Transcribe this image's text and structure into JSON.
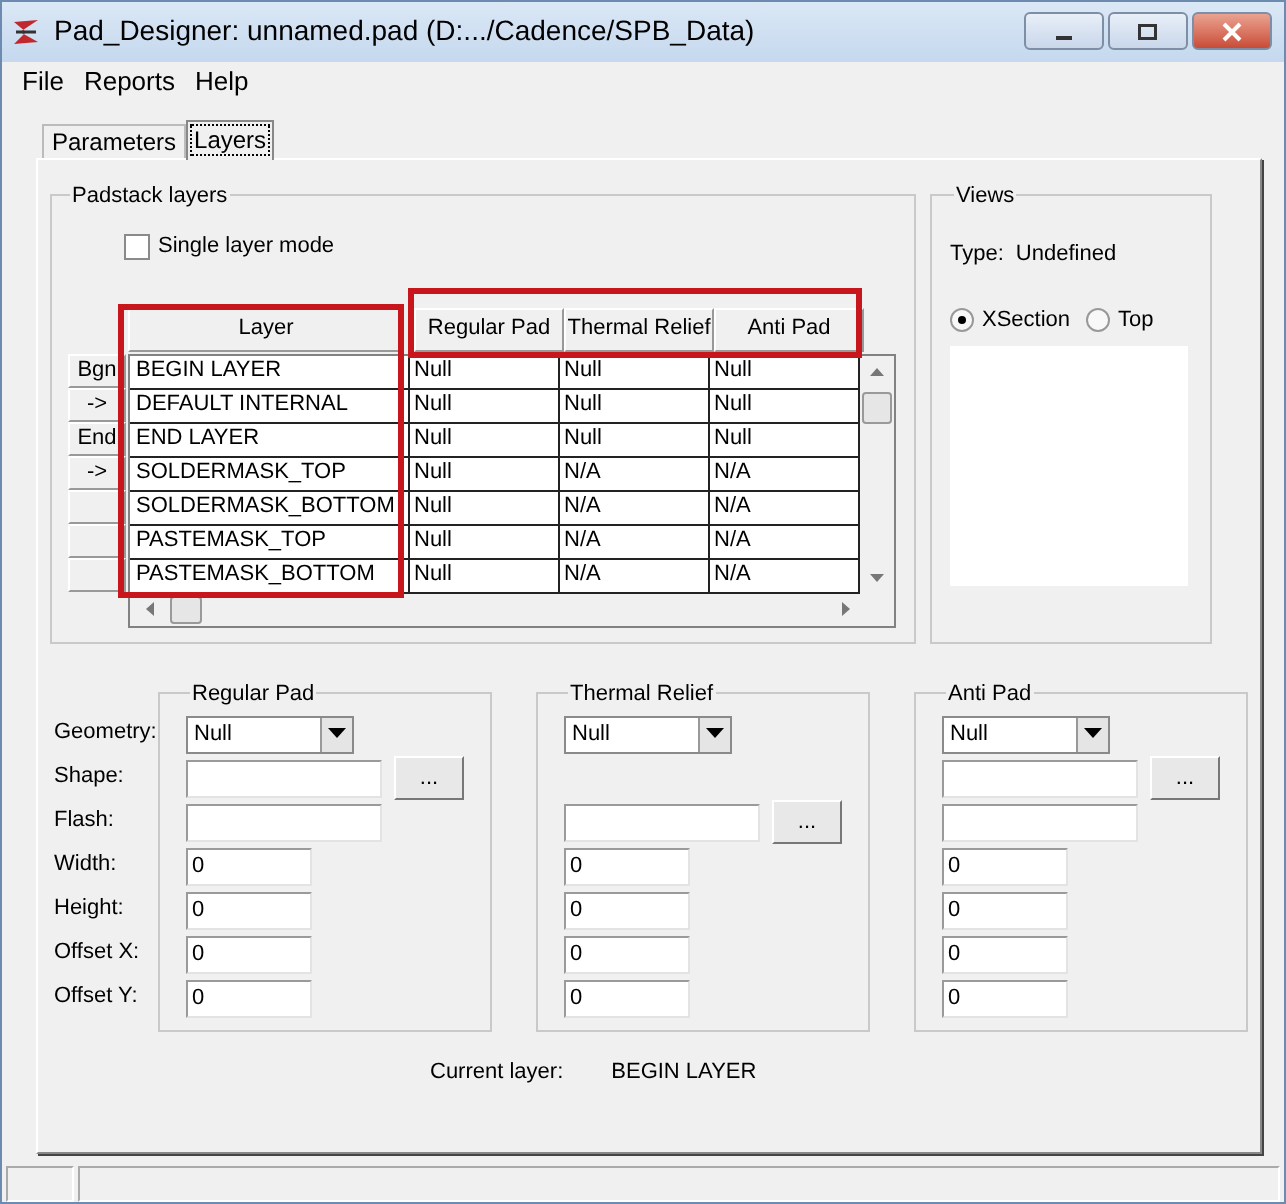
{
  "window": {
    "title": "Pad_Designer: unnamed.pad (D:.../Cadence/SPB_Data)"
  },
  "menu": [
    "File",
    "Reports",
    "Help"
  ],
  "tabs": [
    {
      "label": "Parameters",
      "selected": false
    },
    {
      "label": "Layers",
      "selected": true
    }
  ],
  "padstack_layers": {
    "title": "Padstack layers",
    "single_layer_mode": {
      "label": "Single layer mode",
      "checked": false
    },
    "table": {
      "layer_header": "Layer",
      "pad_headers": [
        "Regular Pad",
        "Thermal Relief",
        "Anti Pad"
      ],
      "layer_column_highlighted": true,
      "pad_headers_highlighted": true,
      "rows": [
        {
          "row_button": "Bgn",
          "layer": "BEGIN LAYER",
          "values": [
            "Null",
            "Null",
            "Null"
          ]
        },
        {
          "row_button": "->",
          "layer": "DEFAULT INTERNAL",
          "values": [
            "Null",
            "Null",
            "Null"
          ]
        },
        {
          "row_button": "End",
          "layer": "END LAYER",
          "values": [
            "Null",
            "Null",
            "Null"
          ]
        },
        {
          "row_button": "->",
          "layer": "SOLDERMASK_TOP",
          "values": [
            "Null",
            "N/A",
            "N/A"
          ]
        },
        {
          "layer": "SOLDERMASK_BOTTOM",
          "values": [
            "Null",
            "N/A",
            "N/A"
          ]
        },
        {
          "layer": "PASTEMASK_TOP",
          "values": [
            "Null",
            "N/A",
            "N/A"
          ]
        },
        {
          "layer": "PASTEMASK_BOTTOM",
          "values": [
            "Null",
            "N/A",
            "N/A"
          ]
        }
      ]
    }
  },
  "views": {
    "title": "Views",
    "type_label": "Type:",
    "type_value": "Undefined",
    "radios": [
      {
        "label": "XSection",
        "selected": true
      },
      {
        "label": "Top",
        "selected": false
      }
    ]
  },
  "field_labels": [
    "Geometry:",
    "Shape:",
    "Flash:",
    "Width:",
    "Height:",
    "Offset X:",
    "Offset Y:"
  ],
  "pad_groups": [
    {
      "title": "Regular Pad",
      "rows": [
        {
          "kind": "dropdown",
          "value": "Null"
        },
        {
          "kind": "wide_field",
          "button": "..."
        },
        {
          "kind": "wide_field"
        },
        {
          "kind": "number_field",
          "value": "0"
        },
        {
          "kind": "number_field",
          "value": "0"
        },
        {
          "kind": "number_field",
          "value": "0"
        },
        {
          "kind": "number_field",
          "value": "0"
        }
      ]
    },
    {
      "title": "Thermal Relief",
      "rows": [
        {
          "kind": "dropdown",
          "value": "Null"
        },
        {
          "kind": "none"
        },
        {
          "kind": "wide_field",
          "button": "..."
        },
        {
          "kind": "number_field",
          "value": "0"
        },
        {
          "kind": "number_field",
          "value": "0"
        },
        {
          "kind": "number_field",
          "value": "0"
        },
        {
          "kind": "number_field",
          "value": "0"
        }
      ]
    },
    {
      "title": "Anti Pad",
      "rows": [
        {
          "kind": "dropdown",
          "value": "Null"
        },
        {
          "kind": "wide_field",
          "button": "..."
        },
        {
          "kind": "wide_field"
        },
        {
          "kind": "number_field",
          "value": "0"
        },
        {
          "kind": "number_field",
          "value": "0"
        },
        {
          "kind": "number_field",
          "value": "0"
        },
        {
          "kind": "number_field",
          "value": "0"
        }
      ]
    }
  ],
  "current_layer": {
    "label": "Current layer:",
    "value": "BEGIN LAYER"
  }
}
